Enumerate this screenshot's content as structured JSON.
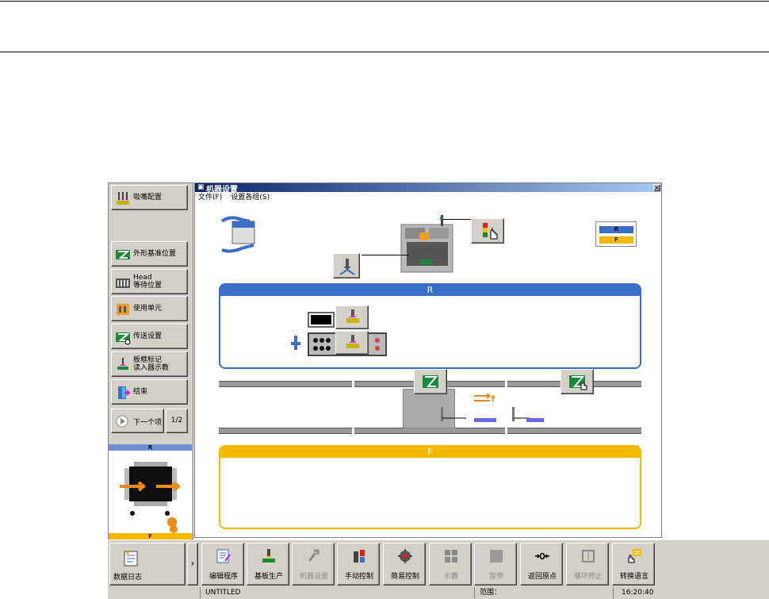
{
  "window": {
    "title": "机器设置",
    "close_glyph": "×"
  },
  "menu": [
    {
      "label": "文件(F)"
    },
    {
      "label": "设置各组(S)"
    }
  ],
  "left_panel": {
    "buttons": [
      {
        "label": "吸嘴配置",
        "icon": "nozzle-config-icon"
      },
      {
        "label": "外形基准位置",
        "icon": "outline-reference-icon"
      },
      {
        "label": "Head\n等待位置",
        "icon": "head-wait-icon"
      },
      {
        "label": "使用单元",
        "icon": "unit-use-icon"
      },
      {
        "label": "传送设置",
        "icon": "conveyor-setting-icon"
      },
      {
        "label": "板框标记\n读入器示教",
        "icon": "mark-reader-icon"
      },
      {
        "label": "结束",
        "icon": "exit-door-icon"
      }
    ],
    "next_label": "下一个项",
    "page": "1/2",
    "mini_r": "R",
    "mini_f": "F"
  },
  "diagram": {
    "legend": {
      "r": "R",
      "f": "F"
    },
    "panel_r": "R",
    "panel_f": "F"
  },
  "toolbar": {
    "log_label": "数据日志",
    "arrow": "›",
    "items": [
      {
        "label": "编辑程序",
        "icon": "edit-program-icon",
        "disabled": false
      },
      {
        "label": "基板生产",
        "icon": "board-production-icon",
        "disabled": false
      },
      {
        "label": "机器设置",
        "icon": "machine-setting-icon",
        "disabled": true
      },
      {
        "label": "手动控制",
        "icon": "manual-control-icon",
        "disabled": false
      },
      {
        "label": "简易控制",
        "icon": "simple-control-icon",
        "disabled": false
      },
      {
        "label": "示教",
        "icon": "teach-icon",
        "disabled": true
      },
      {
        "label": "暂停",
        "icon": "pause-icon",
        "disabled": true
      },
      {
        "label": "返回原点",
        "icon": "return-origin-icon",
        "disabled": false
      },
      {
        "label": "循环停止",
        "icon": "cycle-stop-icon",
        "disabled": true
      },
      {
        "label": "转换语言",
        "icon": "language-icon",
        "disabled": false
      }
    ]
  },
  "status": {
    "program": "UNTITLED",
    "range_label": "范围：",
    "time": "16:20:40"
  },
  "colors": {
    "r_blue": "#3a6ec8",
    "f_yellow": "#f5b800",
    "title_dark": "#0a246a",
    "face": "#d4d0c8"
  }
}
